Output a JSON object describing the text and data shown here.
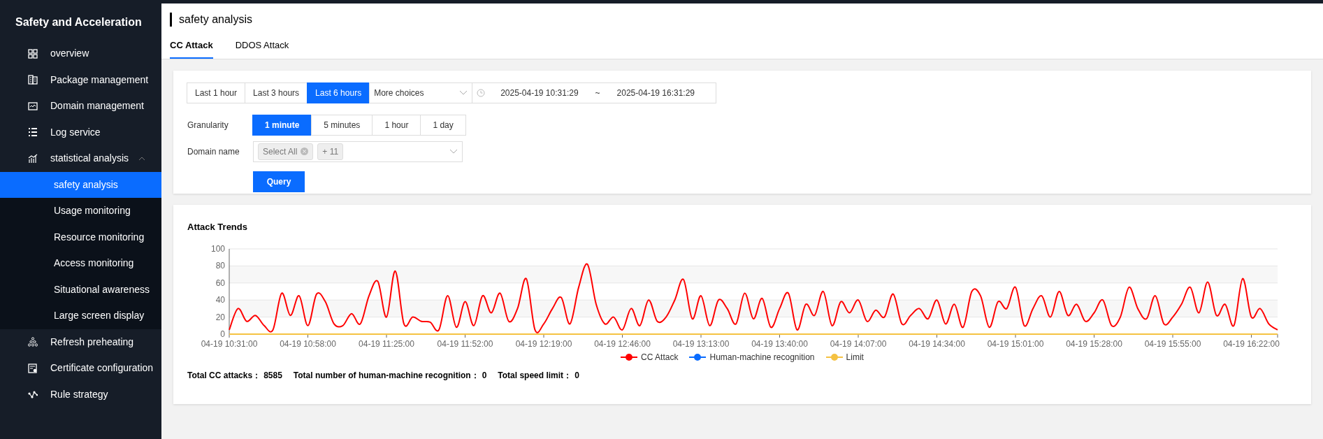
{
  "sidebar": {
    "title": "Safety and Acceleration",
    "items": [
      {
        "label": "overview",
        "selected": false
      },
      {
        "label": "Package management",
        "selected": false
      },
      {
        "label": "Domain management",
        "selected": false
      },
      {
        "label": "Log service",
        "selected": false
      },
      {
        "label": "statistical analysis",
        "selected": false,
        "expanded": true,
        "children": [
          {
            "label": "safety analysis",
            "selected": true
          },
          {
            "label": "Usage monitoring",
            "selected": false
          },
          {
            "label": "Resource monitoring",
            "selected": false
          },
          {
            "label": "Access monitoring",
            "selected": false
          },
          {
            "label": "Situational awareness",
            "selected": false
          },
          {
            "label": "Large screen display",
            "selected": false
          }
        ]
      },
      {
        "label": "Refresh preheating",
        "selected": false
      },
      {
        "label": "Certificate configuration",
        "selected": false
      },
      {
        "label": "Rule strategy",
        "selected": false
      }
    ]
  },
  "page": {
    "title": "safety analysis",
    "tabs": [
      {
        "label": "CC Attack",
        "selected": true
      },
      {
        "label": "DDOS Attack",
        "selected": false
      }
    ]
  },
  "filters": {
    "time_presets": [
      {
        "label": "Last 1 hour",
        "selected": false
      },
      {
        "label": "Last 3 hours",
        "selected": false
      },
      {
        "label": "Last 6 hours",
        "selected": true
      }
    ],
    "more_choices": {
      "label": "More choices"
    },
    "date_range": {
      "start": "2025-04-19 10:31:29",
      "separator": "~",
      "end": "2025-04-19 16:31:29"
    },
    "granularity": {
      "label": "Granularity",
      "options": [
        {
          "label": "1 minute",
          "selected": true
        },
        {
          "label": "5 minutes",
          "selected": false
        },
        {
          "label": "1 hour",
          "selected": false
        },
        {
          "label": "1 day",
          "selected": false
        }
      ]
    },
    "domain": {
      "label": "Domain name",
      "tags": [
        {
          "label": "Select All",
          "removable": true
        },
        {
          "label": "+ 11",
          "removable": false
        }
      ]
    },
    "query_button": "Query"
  },
  "attack_trends": {
    "title": "Attack Trends",
    "chart_data": {
      "type": "line",
      "categories": [
        "04-19 10:31:00",
        null,
        null,
        null,
        null,
        null,
        null,
        null,
        null,
        "04-19 10:58:00",
        null,
        null,
        null,
        null,
        null,
        null,
        null,
        null,
        "04-19 11:25:00",
        null,
        null,
        null,
        null,
        null,
        null,
        null,
        null,
        "04-19 11:52:00",
        null,
        null,
        null,
        null,
        null,
        null,
        null,
        null,
        "04-19 12:19:00",
        null,
        null,
        null,
        null,
        null,
        null,
        null,
        null,
        "04-19 12:46:00",
        null,
        null,
        null,
        null,
        null,
        null,
        null,
        null,
        "04-19 13:13:00",
        null,
        null,
        null,
        null,
        null,
        null,
        null,
        null,
        "04-19 13:40:00",
        null,
        null,
        null,
        null,
        null,
        null,
        null,
        null,
        "04-19 14:07:00",
        null,
        null,
        null,
        null,
        null,
        null,
        null,
        null,
        "04-19 14:34:00",
        null,
        null,
        null,
        null,
        null,
        null,
        null,
        null,
        "04-19 15:01:00",
        null,
        null,
        null,
        null,
        null,
        null,
        null,
        null,
        "04-19 15:28:00",
        null,
        null,
        null,
        null,
        null,
        null,
        null,
        null,
        "04-19 15:55:00",
        null,
        null,
        null,
        null,
        null,
        null,
        null,
        null,
        "04-19 16:22:00",
        null,
        null,
        null
      ],
      "ylim": [
        0,
        100
      ],
      "yticks": [
        0,
        20,
        40,
        60,
        80,
        100
      ],
      "grid": true,
      "series": [
        {
          "name": "CC Attack",
          "color": "#ff0000",
          "values": [
            5,
            30,
            15,
            22,
            10,
            5,
            48,
            22,
            45,
            10,
            47,
            38,
            12,
            10,
            24,
            12,
            45,
            62,
            20,
            74,
            12,
            20,
            15,
            14,
            5,
            45,
            8,
            38,
            10,
            45,
            25,
            48,
            15,
            30,
            65,
            5,
            12,
            30,
            43,
            12,
            55,
            82,
            35,
            12,
            20,
            5,
            30,
            10,
            40,
            15,
            20,
            40,
            64,
            18,
            45,
            10,
            40,
            30,
            12,
            48,
            18,
            42,
            8,
            30,
            48,
            5,
            35,
            22,
            50,
            10,
            38,
            25,
            40,
            15,
            28,
            20,
            47,
            12,
            22,
            30,
            18,
            40,
            12,
            35,
            8,
            50,
            45,
            8,
            38,
            30,
            55,
            10,
            30,
            45,
            20,
            50,
            22,
            35,
            15,
            25,
            40,
            10,
            20,
            55,
            30,
            18,
            45,
            12,
            20,
            35,
            55,
            25,
            61,
            22,
            35,
            10,
            65,
            20,
            30,
            12,
            5
          ]
        },
        {
          "name": "Human-machine recognition",
          "color": "#0a6cff",
          "values": [
            null,
            null,
            null,
            null,
            null,
            null,
            null,
            null,
            null,
            null,
            null,
            null,
            null,
            null,
            null,
            null,
            null,
            null,
            null,
            null,
            null,
            null,
            null,
            null,
            null,
            null,
            null,
            null,
            null,
            null,
            null,
            null,
            null,
            null,
            null,
            null,
            null,
            null,
            null,
            null,
            null,
            null,
            null,
            null,
            null,
            null,
            null,
            null,
            null,
            null,
            null,
            null,
            null,
            null,
            null,
            null,
            null,
            null,
            null,
            null,
            null,
            null,
            null,
            null,
            null,
            null,
            null,
            null,
            null,
            null,
            null,
            null,
            null,
            null,
            null,
            null,
            null,
            null,
            null,
            null,
            null,
            null,
            null,
            null,
            null,
            null,
            null,
            null,
            null,
            null,
            null,
            null,
            null,
            null,
            null,
            null,
            null,
            null,
            null,
            null,
            null,
            null,
            null,
            null,
            null,
            null,
            null,
            null,
            null,
            null,
            null,
            null,
            null,
            null,
            null,
            null,
            null,
            null,
            null,
            null,
            null
          ]
        },
        {
          "name": "Limit",
          "color": "#f5c242",
          "values": [
            0,
            0,
            0,
            0,
            0,
            0,
            0,
            0,
            0,
            0,
            0,
            0,
            0,
            0,
            0,
            0,
            0,
            0,
            0,
            0,
            0,
            0,
            0,
            0,
            0,
            0,
            0,
            0,
            0,
            0,
            0,
            0,
            0,
            0,
            0,
            0,
            0,
            0,
            0,
            0,
            0,
            0,
            0,
            0,
            0,
            0,
            0,
            0,
            0,
            0,
            0,
            0,
            0,
            0,
            0,
            0,
            0,
            0,
            0,
            0,
            0,
            0,
            0,
            0,
            0,
            0,
            0,
            0,
            0,
            0,
            0,
            0,
            0,
            0,
            0,
            0,
            0,
            0,
            0,
            0,
            0,
            0,
            0,
            0,
            0,
            0,
            0,
            0,
            0,
            0,
            0,
            0,
            0,
            0,
            0,
            0,
            0,
            0,
            0,
            0,
            0,
            0,
            0,
            0,
            0,
            0,
            0,
            0,
            0,
            0,
            0,
            0,
            0,
            0,
            0,
            0,
            0,
            0,
            0,
            0,
            0
          ]
        }
      ]
    },
    "totals": [
      {
        "label": "Total CC attacks：",
        "value": "8585"
      },
      {
        "label": "Total number of human-machine recognition：",
        "value": "0"
      },
      {
        "label": "Total speed limit：",
        "value": "0"
      }
    ]
  }
}
